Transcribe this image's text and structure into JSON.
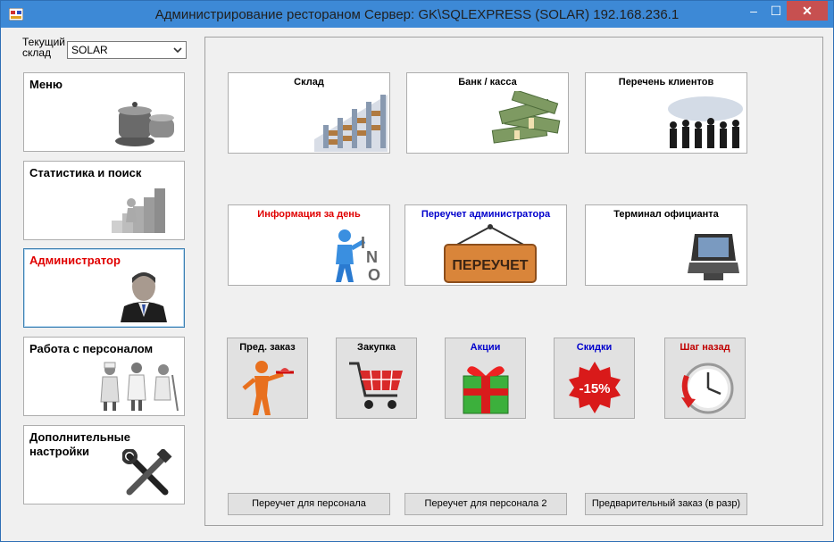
{
  "window": {
    "title": "Администрирование рестораном  Сервер: GK\\SQLEXPRESS (SOLAR) 192.168.236.1",
    "minimize": "–",
    "maximize": "☐",
    "close": "✕"
  },
  "store": {
    "label": "Текущий склад",
    "value": "SOLAR"
  },
  "nav": [
    {
      "label": "Меню",
      "icon": "pots-icon"
    },
    {
      "label": "Статистика и поиск",
      "icon": "stats-icon"
    },
    {
      "label": "Администратор",
      "icon": "admin-icon",
      "active": true
    },
    {
      "label": "Работа с персоналом",
      "icon": "staff-icon"
    },
    {
      "label": "Дополнительные настройки",
      "icon": "tools-icon"
    }
  ],
  "tiles": [
    {
      "label": "Склад",
      "color": "#000000"
    },
    {
      "label": "Банк / касса",
      "color": "#000000"
    },
    {
      "label": "Перечень клиентов",
      "color": "#000000"
    },
    {
      "label": "Информация за день",
      "color": "#e00000"
    },
    {
      "label": "Переучет администратора",
      "color": "#0000cc"
    },
    {
      "label": "Терминал официанта",
      "color": "#000000"
    }
  ],
  "sign_text": "ПЕРЕУЧЕТ",
  "small": [
    {
      "label": "Пред. заказ",
      "color": "#000000"
    },
    {
      "label": "Закупка",
      "color": "#000000"
    },
    {
      "label": "Акции",
      "color": "#0000cc"
    },
    {
      "label": "Скидки",
      "color": "#0000cc"
    },
    {
      "label": "Шаг назад",
      "color": "#c00000"
    }
  ],
  "discount_text": "-15%",
  "bottom": [
    "Переучет для персонала",
    "Переучет для персонала 2",
    "Предварительный заказ (в разр)"
  ]
}
